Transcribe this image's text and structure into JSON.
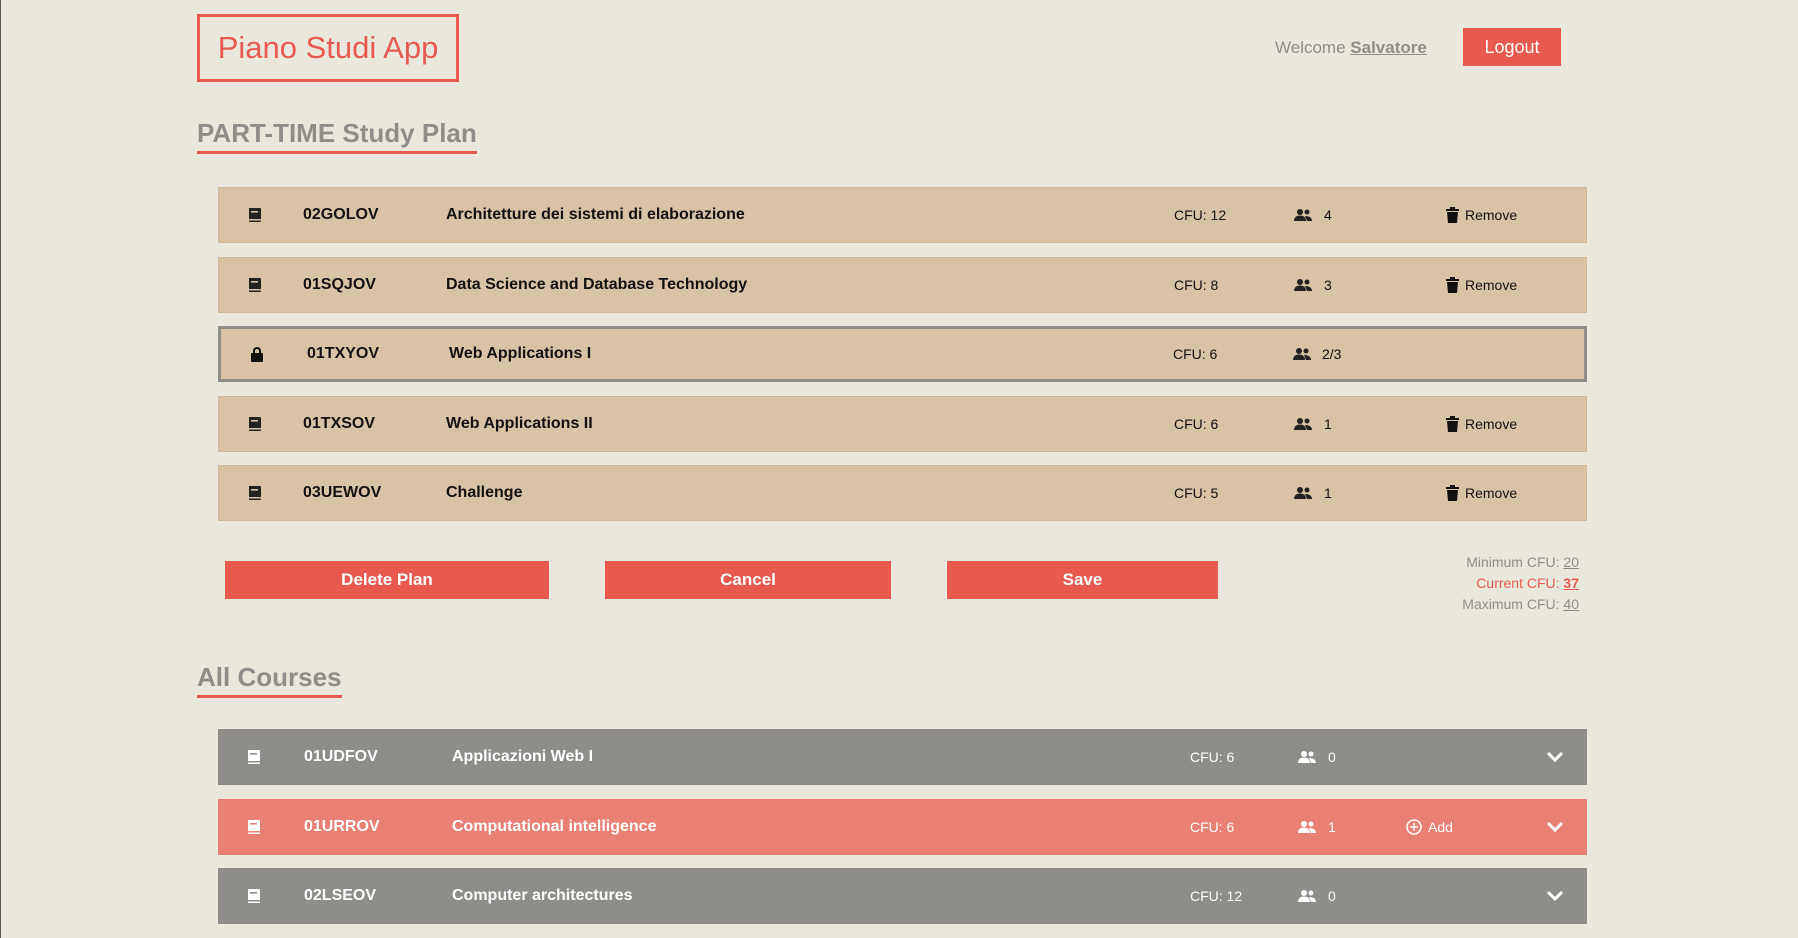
{
  "header": {
    "brand": "Piano Studi App",
    "welcome_prefix": "Welcome",
    "username": "Salvatore",
    "logout_label": "Logout"
  },
  "plan": {
    "title": "PART-TIME Study Plan",
    "courses": [
      {
        "code": "02GOLOV",
        "name": "Architetture dei sistemi di elaborazione",
        "cfu": "CFU: 12",
        "students": "4",
        "action": "Remove",
        "icon": "book-icon"
      },
      {
        "code": "01SQJOV",
        "name": "Data Science and Database Technology",
        "cfu": "CFU: 8",
        "students": "3",
        "action": "Remove",
        "icon": "book-icon"
      },
      {
        "code": "01TXYOV",
        "name": "Web Applications I",
        "cfu": "CFU: 6",
        "students": "2/3",
        "action": "",
        "icon": "lock-icon"
      },
      {
        "code": "01TXSOV",
        "name": "Web Applications II",
        "cfu": "CFU: 6",
        "students": "1",
        "action": "Remove",
        "icon": "book-icon"
      },
      {
        "code": "03UEWOV",
        "name": "Challenge",
        "cfu": "CFU: 5",
        "students": "1",
        "action": "Remove",
        "icon": "book-icon"
      }
    ],
    "buttons": {
      "delete": "Delete Plan",
      "cancel": "Cancel",
      "save": "Save"
    },
    "cfu_summary": {
      "min_label": "Minimum CFU:",
      "min_value": "20",
      "current_label": "Current CFU:",
      "current_value": "37",
      "max_label": "Maximum CFU:",
      "max_value": "40"
    }
  },
  "all_courses": {
    "title": "All Courses",
    "courses": [
      {
        "code": "01UDFOV",
        "name": "Applicazioni Web I",
        "cfu": "CFU: 6",
        "students": "0",
        "action": "",
        "status": "unavailable"
      },
      {
        "code": "01URROV",
        "name": "Computational intelligence",
        "cfu": "CFU: 6",
        "students": "1",
        "action": "Add",
        "status": "addable"
      },
      {
        "code": "02LSEOV",
        "name": "Computer architectures",
        "cfu": "CFU: 12",
        "students": "0",
        "action": "",
        "status": "unavailable"
      }
    ]
  },
  "colors": {
    "background": "#eae7dc",
    "accent": "#e85a4f",
    "plan_row": "#d8c3a5",
    "course_row": "#8e8d8a",
    "addable_row": "#e98074"
  }
}
